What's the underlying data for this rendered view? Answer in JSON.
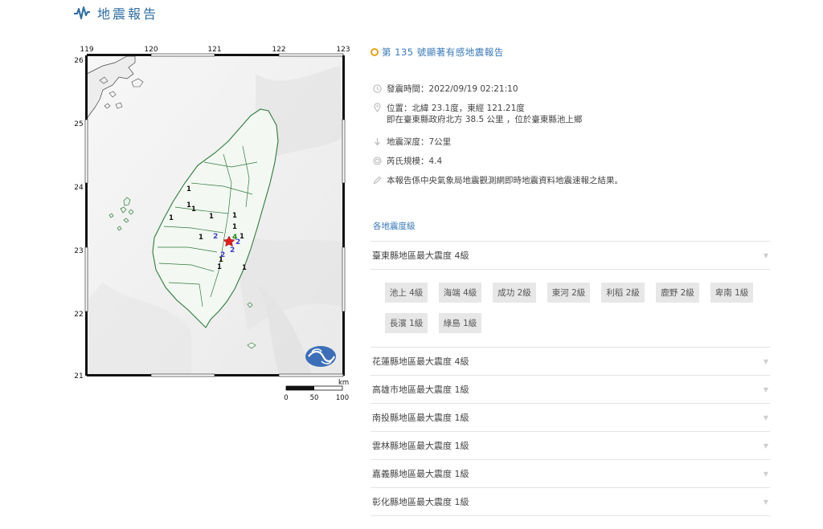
{
  "header": {
    "title": "地震報告"
  },
  "report": {
    "title": "第 135 號顯著有感地震報告",
    "time": "發震時間：2022/09/19 02:21:10",
    "location": "位置：北緯 23.1度，東經 121.21度",
    "location_detail": "即在臺東縣政府北方 38.5 公里 ，位於臺東縣池上鄉",
    "depth": "地震深度：7公里",
    "magnitude": "芮氏規模：4.4",
    "note": "本報告係中央氣象局地震觀測網即時地震資料地震速報之結果。"
  },
  "map": {
    "top_lon_ticks": [
      "119",
      "120",
      "121",
      "122",
      "123"
    ],
    "left_lat_ticks": [
      "26",
      "25",
      "24",
      "23",
      "22",
      "21"
    ],
    "scale_unit": "km",
    "scale_labels": [
      "0",
      "50",
      "100"
    ],
    "intensity_marks_red": [
      "1",
      "1",
      "1",
      "1",
      "1",
      "1",
      "1",
      "1",
      "1",
      "1",
      "1",
      "1"
    ],
    "intensity_marks_blue": [
      "2",
      "2",
      "2",
      "2",
      "4"
    ]
  },
  "intensity_section": {
    "title": "各地震度級"
  },
  "regions": [
    {
      "label": "臺東縣地區最大震度 4級",
      "expanded": true,
      "stations": [
        "池上 4級",
        "海端 4級",
        "成功 2級",
        "東河 2級",
        "利稻 2級",
        "鹿野 2級",
        "卑南 1級",
        "長濱 1級",
        "綠島 1級"
      ]
    },
    {
      "label": "花蓮縣地區最大震度 4級",
      "expanded": false
    },
    {
      "label": "高雄市地區最大震度 1級",
      "expanded": false
    },
    {
      "label": "南投縣地區最大震度 1級",
      "expanded": false
    },
    {
      "label": "雲林縣地區最大震度 1級",
      "expanded": false
    },
    {
      "label": "嘉義縣地區最大震度 1級",
      "expanded": false
    },
    {
      "label": "彰化縣地區最大震度 1級",
      "expanded": false
    }
  ],
  "colors": {
    "accent": "#3a7ab8",
    "ring": "#e8a317",
    "epicenter": "#e02020",
    "intensity_blue": "#3a3ad0",
    "county_border": "#2f7a3a"
  }
}
